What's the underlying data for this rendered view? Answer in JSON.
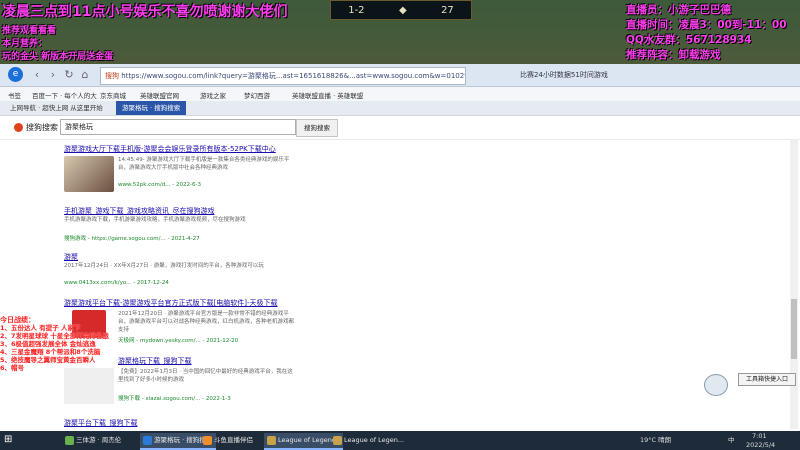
{
  "game": {
    "score": "1-2",
    "timer": "27"
  },
  "overlay": {
    "left_title": "凌晨三点到11点小号娱乐不喜勿喷谢谢大佬们",
    "left_line1": "推荐观看看看",
    "left_line2": "本月营养：",
    "left_line3": "玩的金尖 新版本开局送金蛋",
    "right_line1": "直播员：小游子巴巴德",
    "right_line2": "直播时间：凌晨3：00到-11：00",
    "right_line3": "QQ水友群：567128934",
    "right_line4": "推荐阵容：卸载游戏"
  },
  "browser": {
    "address_prefix": "搜狗",
    "address_url": "https://www.sogou.com/link?query=游聚格玩...ast=1651618826&...ast=www.sogou.com&w=01029901&dp=...",
    "right_text": "比赛24小时数据51时间游戏",
    "bookmarks": [
      "书签",
      "百度一下 · 每个人的大",
      "京东商城",
      "英雄联盟官网",
      "游戏之家",
      "梦幻西游",
      "英雄联盟直播 · 英雄联盟"
    ],
    "tabs": [
      "上网导航 · 超快上网 从这里开始",
      "游聚格玩 · 搜狗搜索"
    ],
    "search_logo": "搜狗搜索",
    "search_query": "游聚格玩",
    "search_button": "搜狗搜索"
  },
  "results": [
    {
      "title": "游聚游戏大厅下载手机版-游聚会会娱乐登录所有版本-52PK下载中心",
      "desc": "14:45:49- 游聚游戏大厅下载手机版是一款集合各类经典游戏的娱乐平台，游聚游戏大厅手机版中社会各种经典游戏",
      "url": "www.52pk.com/d... - 2022-6-3"
    },
    {
      "title": "手机游聚_游戏下载_游戏攻略资讯_尽在搜狗游戏",
      "desc": "手机游聚游戏下载，手机游聚游戏攻略，手机游聚游戏视频，尽在搜狗游戏",
      "url": "搜狗游戏 - https://game.sogou.com/... - 2021-4-27"
    },
    {
      "title": "游聚",
      "desc": "2017年12月24日 · XX年X月27日 · 游聚，游戏打发时间的平台，各种游戏可以玩",
      "url": "www.0413xx.com/k/yo... - 2017-12-24"
    },
    {
      "title": "游聚游戏平台下载-游聚游戏平台官方正式版下载[电脑软件]-天极下载",
      "desc": "2021年12月20日 · 游聚游戏平台官方版是一款非常不错的经典游戏平台，游聚游戏平台可以对战各种经典游戏，红白机游戏，各种老机游戏都支持",
      "url": "天极网 - mydown.yesky.com/... - 2021-12-20"
    },
    {
      "title": "游聚格玩下载_搜狗下载",
      "desc": "【免费】2022年1月3日 · 当中国的回忆中最好的经典游戏平台，我在这里找到了好多小时候的游戏",
      "url": "搜狗下载 - xiazai.sogou.com/... - 2022-1-3"
    },
    {
      "title": "游聚平台下载_搜狗下载",
      "desc": "",
      "url": ""
    }
  ],
  "daily": {
    "header": "今日战绩：",
    "items": [
      "1、五份达人 有提子 人家下",
      "2、7发明星球球 十星全部打完排名战",
      "3、6极值超强发展全体 金灿逃逸",
      "4、三星金魔翔 8个帮派和8个洗脑",
      "5、绝技魔导之翼师宝黄金百瞬人",
      "6、帽号"
    ]
  },
  "panel": {
    "tool_button": "工具箱快捷入口"
  },
  "taskbar": {
    "items": [
      "三体游 · 周杰伦",
      "游聚格玩 · 搜狗搜索",
      "斗鱼直播伴侣",
      "League of Legends",
      "League of Legen..."
    ],
    "weather": "19°C 晴朗",
    "time": "7:01",
    "date": "2022/5/4",
    "lang": "中"
  }
}
